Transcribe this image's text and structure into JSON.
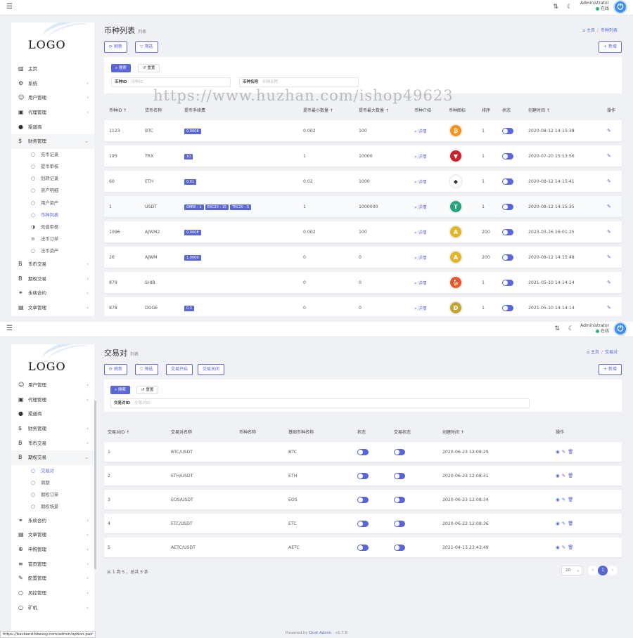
{
  "topbar": {
    "username": "Administrator",
    "status": "在线"
  },
  "logo": "LOGO",
  "watermark": "https://www.huzhan.com/ishop49623",
  "p1": {
    "title": "币种列表",
    "subtitle": "列表",
    "breadcrumb": {
      "home": "主页",
      "current": "币种列表"
    },
    "buttons": {
      "refresh": "刷新",
      "filter": "筛选",
      "add": "+ 新增"
    },
    "search": {
      "search": "搜索",
      "reset": "重置"
    },
    "filters": [
      {
        "label": "币种ID",
        "placeholder": "币种ID"
      },
      {
        "label": "币种名称",
        "placeholder": "币种名称"
      }
    ],
    "nav": [
      {
        "icon": "▥",
        "label": "主页",
        "name": "chart-icon"
      },
      {
        "icon": "⚙",
        "label": "系统",
        "chev": "‹",
        "name": "gear-icon"
      },
      {
        "icon": "☺",
        "label": "用户管理",
        "chev": "‹",
        "name": "users-icon"
      },
      {
        "icon": "▣",
        "label": "代理管理",
        "chev": "‹",
        "name": "id-card-icon"
      },
      {
        "icon": "●",
        "label": "渠道商",
        "name": "user-circle-icon"
      },
      {
        "icon": "$",
        "label": "财务管理",
        "chev": "⌄",
        "open": true,
        "name": "dollar-icon"
      },
      {
        "icon": "○",
        "label": "充币记录",
        "sub": true,
        "name": "circle-icon"
      },
      {
        "icon": "○",
        "label": "提币审核",
        "sub": true,
        "name": "circle-icon"
      },
      {
        "icon": "○",
        "label": "划转记录",
        "sub": true,
        "name": "circle-icon"
      },
      {
        "icon": "○",
        "label": "资产明细",
        "sub": true,
        "name": "circle-icon"
      },
      {
        "icon": "○",
        "label": "用户资产",
        "sub": true,
        "name": "circle-icon"
      },
      {
        "icon": "○",
        "label": "币种列表",
        "sub": true,
        "active": true,
        "name": "circle-icon"
      },
      {
        "icon": "◑",
        "label": "充值审核",
        "sub": true,
        "name": "half-circle-icon"
      },
      {
        "icon": "≡",
        "label": "法币订单",
        "sub": true,
        "name": "list-icon"
      },
      {
        "icon": "○",
        "label": "法币资产",
        "sub": true,
        "name": "circle-icon"
      },
      {
        "icon": "B",
        "label": "币币交易",
        "chev": "‹",
        "name": "bitcoin-icon"
      },
      {
        "icon": "B",
        "label": "期权交易",
        "chev": "‹",
        "name": "bitcoin-icon"
      },
      {
        "icon": "⚭",
        "label": "永续合约",
        "chev": "‹",
        "name": "link-icon"
      },
      {
        "icon": "▤",
        "label": "文章管理",
        "chev": "‹",
        "name": "newspaper-icon"
      }
    ],
    "columns": [
      "币种ID ↑",
      "货币名称",
      "提币手续费",
      "提币最小数量 ↑",
      "提币最大数量 ↑",
      "币种介绍",
      "币种图标",
      "排序",
      "状态",
      "创建时间 ↑",
      "操作"
    ],
    "rows": [
      {
        "id": "1123",
        "name": "BTC",
        "fee": [
          "0.0008"
        ],
        "min": "0.002",
        "max": "100",
        "detail": "» 详情",
        "coin": "₿",
        "coinColor": "#f7931a",
        "sort": "1",
        "time": "2020-08-12 14:15:38"
      },
      {
        "id": "195",
        "name": "TRX",
        "fee": [
          "10"
        ],
        "min": "1",
        "max": "10000",
        "detail": "» 详情",
        "coin": "▼",
        "coinColor": "#c8232c",
        "sort": "1",
        "time": "2020-07-20 15:13:56"
      },
      {
        "id": "60",
        "name": "ETH",
        "fee": [
          "0.01"
        ],
        "min": "0.02",
        "max": "1000",
        "detail": "» 详情",
        "coin": "◆",
        "coinColor": "#ffffff",
        "coinText": "#333",
        "sort": "1",
        "time": "2020-08-12 14:15:41"
      },
      {
        "id": "1",
        "name": "USDT",
        "fee": [
          "OMNI : 1",
          "ERC20 : 15",
          "TRC20 : 5"
        ],
        "min": "1",
        "max": "1000000",
        "detail": "» 详情",
        "coin": "T",
        "coinColor": "#26a17b",
        "sort": "1",
        "time": "2020-08-12 14:15:35"
      },
      {
        "id": "1096",
        "name": "AJWM2",
        "fee": [
          "0.0008"
        ],
        "min": "0.002",
        "max": "100",
        "detail": "» 详情",
        "coin": "A",
        "coinColor": "#e0b52a",
        "sort": "200",
        "time": "2023-03-16 16:01:25"
      },
      {
        "id": "26",
        "name": "AJWM",
        "fee": [
          "1.0000"
        ],
        "min": "0",
        "max": "0",
        "detail": "» 详情",
        "coin": "A",
        "coinColor": "#e0b52a",
        "sort": "200",
        "time": "2020-08-12 14:15:48"
      },
      {
        "id": "879",
        "name": "SHIB",
        "fee": [],
        "min": "0",
        "max": "0",
        "detail": "» 详情",
        "coin": "🐕",
        "coinColor": "#e8562a",
        "sort": "1",
        "time": "2021-05-10 14:14:14"
      },
      {
        "id": "878",
        "name": "DOGE",
        "fee": [
          "0.3"
        ],
        "min": "0",
        "max": "0",
        "detail": "» 详情",
        "coin": "Ð",
        "coinColor": "#c2a633",
        "sort": "1",
        "time": "2021-05-10 14:14:14"
      }
    ]
  },
  "p2": {
    "title": "交易对",
    "subtitle": "列表",
    "breadcrumb": {
      "home": "主页",
      "current": "交易对"
    },
    "buttons": {
      "refresh": "刷新",
      "filter": "筛选",
      "open": "交易开启",
      "close": "交易关闭",
      "add": "+ 新增"
    },
    "search": {
      "search": "搜索",
      "reset": "重置"
    },
    "filters": [
      {
        "label": "交易对ID",
        "placeholder": "交易对ID"
      }
    ],
    "nav": [
      {
        "icon": "☺",
        "label": "用户管理",
        "chev": "‹",
        "name": "users-icon"
      },
      {
        "icon": "▣",
        "label": "代理管理",
        "chev": "‹",
        "name": "id-card-icon"
      },
      {
        "icon": "●",
        "label": "渠道商",
        "name": "user-circle-icon"
      },
      {
        "icon": "$",
        "label": "财务管理",
        "chev": "‹",
        "name": "dollar-icon"
      },
      {
        "icon": "B",
        "label": "币币交易",
        "chev": "‹",
        "name": "bitcoin-icon"
      },
      {
        "icon": "B",
        "label": "期权交易",
        "chev": "⌄",
        "open": true,
        "name": "bitcoin-icon"
      },
      {
        "icon": "○",
        "label": "交易对",
        "sub": true,
        "active": true,
        "name": "circle-icon"
      },
      {
        "icon": "○",
        "label": "周期",
        "sub": true,
        "name": "circle-icon"
      },
      {
        "icon": "○",
        "label": "期权订单",
        "sub": true,
        "name": "circle-icon"
      },
      {
        "icon": "○",
        "label": "期权场景",
        "sub": true,
        "name": "circle-icon"
      },
      {
        "icon": "⚭",
        "label": "永续合约",
        "chev": "‹",
        "name": "link-icon"
      },
      {
        "icon": "▤",
        "label": "文章管理",
        "chev": "‹",
        "name": "newspaper-icon"
      },
      {
        "icon": "⊕",
        "label": "申购管理",
        "chev": "‹",
        "name": "globe-icon"
      },
      {
        "icon": "≡",
        "label": "首页管理",
        "chev": "‹",
        "name": "list-icon"
      },
      {
        "icon": "✎",
        "label": "配置管理",
        "chev": "‹",
        "name": "wrench-icon"
      },
      {
        "icon": "○",
        "label": "风控管理",
        "chev": "‹",
        "name": "circle-icon"
      },
      {
        "icon": "○",
        "label": "矿机",
        "chev": "‹",
        "name": "circle-icon"
      }
    ],
    "columns": [
      "交易对ID ↑",
      "交易对名称",
      "币种名称",
      "基础币种名称",
      "状态",
      "交易状态",
      "创建时间 ↑",
      "操作"
    ],
    "rows": [
      {
        "id": "1",
        "pair": "BTC/USDT",
        "base": "BTC",
        "time": "2020-06-23 12:08:29"
      },
      {
        "id": "2",
        "pair": "ETH/USDT",
        "base": "ETH",
        "time": "2020-06-23 12:08:31"
      },
      {
        "id": "3",
        "pair": "EOS/USDT",
        "base": "EOS",
        "time": "2020-06-23 12:08:34"
      },
      {
        "id": "4",
        "pair": "ETC/USDT",
        "base": "ETC",
        "time": "2020-06-23 12:08:36"
      },
      {
        "id": "5",
        "pair": "AETC/USDT",
        "base": "AETC",
        "time": "2021-04-13 23:43:49"
      }
    ],
    "pager": {
      "info": "从 1 到 5 ，总共 5 条",
      "perPage": "20",
      "page": "1",
      "prev": "‹",
      "next": "›"
    },
    "footer": {
      "prefix": "Powered by",
      "link": "Dcat Admin",
      "version": "· v1.7.8"
    },
    "statusbar": "https://backend.bbexsy.com/admin/option-pair"
  }
}
